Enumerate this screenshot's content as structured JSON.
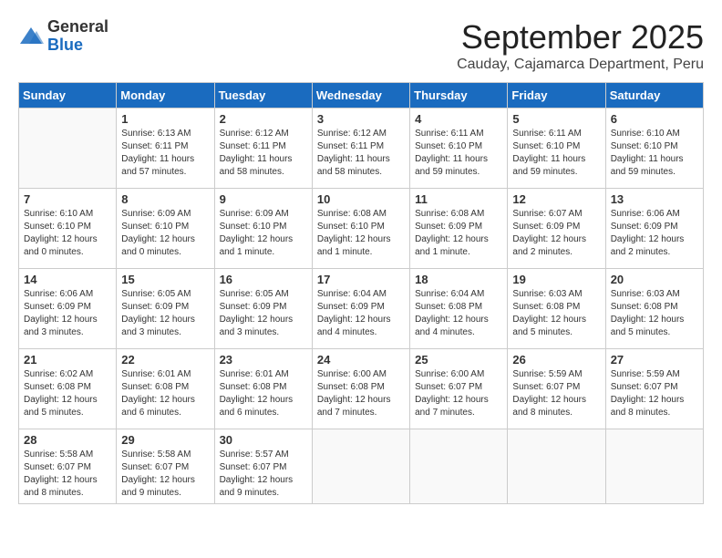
{
  "header": {
    "logo_general": "General",
    "logo_blue": "Blue",
    "month_title": "September 2025",
    "location": "Cauday, Cajamarca Department, Peru"
  },
  "days_of_week": [
    "Sunday",
    "Monday",
    "Tuesday",
    "Wednesday",
    "Thursday",
    "Friday",
    "Saturday"
  ],
  "weeks": [
    [
      {
        "day": "",
        "info": ""
      },
      {
        "day": "1",
        "info": "Sunrise: 6:13 AM\nSunset: 6:11 PM\nDaylight: 11 hours\nand 57 minutes."
      },
      {
        "day": "2",
        "info": "Sunrise: 6:12 AM\nSunset: 6:11 PM\nDaylight: 11 hours\nand 58 minutes."
      },
      {
        "day": "3",
        "info": "Sunrise: 6:12 AM\nSunset: 6:11 PM\nDaylight: 11 hours\nand 58 minutes."
      },
      {
        "day": "4",
        "info": "Sunrise: 6:11 AM\nSunset: 6:10 PM\nDaylight: 11 hours\nand 59 minutes."
      },
      {
        "day": "5",
        "info": "Sunrise: 6:11 AM\nSunset: 6:10 PM\nDaylight: 11 hours\nand 59 minutes."
      },
      {
        "day": "6",
        "info": "Sunrise: 6:10 AM\nSunset: 6:10 PM\nDaylight: 11 hours\nand 59 minutes."
      }
    ],
    [
      {
        "day": "7",
        "info": "Sunrise: 6:10 AM\nSunset: 6:10 PM\nDaylight: 12 hours\nand 0 minutes."
      },
      {
        "day": "8",
        "info": "Sunrise: 6:09 AM\nSunset: 6:10 PM\nDaylight: 12 hours\nand 0 minutes."
      },
      {
        "day": "9",
        "info": "Sunrise: 6:09 AM\nSunset: 6:10 PM\nDaylight: 12 hours\nand 1 minute."
      },
      {
        "day": "10",
        "info": "Sunrise: 6:08 AM\nSunset: 6:10 PM\nDaylight: 12 hours\nand 1 minute."
      },
      {
        "day": "11",
        "info": "Sunrise: 6:08 AM\nSunset: 6:09 PM\nDaylight: 12 hours\nand 1 minute."
      },
      {
        "day": "12",
        "info": "Sunrise: 6:07 AM\nSunset: 6:09 PM\nDaylight: 12 hours\nand 2 minutes."
      },
      {
        "day": "13",
        "info": "Sunrise: 6:06 AM\nSunset: 6:09 PM\nDaylight: 12 hours\nand 2 minutes."
      }
    ],
    [
      {
        "day": "14",
        "info": "Sunrise: 6:06 AM\nSunset: 6:09 PM\nDaylight: 12 hours\nand 3 minutes."
      },
      {
        "day": "15",
        "info": "Sunrise: 6:05 AM\nSunset: 6:09 PM\nDaylight: 12 hours\nand 3 minutes."
      },
      {
        "day": "16",
        "info": "Sunrise: 6:05 AM\nSunset: 6:09 PM\nDaylight: 12 hours\nand 3 minutes."
      },
      {
        "day": "17",
        "info": "Sunrise: 6:04 AM\nSunset: 6:09 PM\nDaylight: 12 hours\nand 4 minutes."
      },
      {
        "day": "18",
        "info": "Sunrise: 6:04 AM\nSunset: 6:08 PM\nDaylight: 12 hours\nand 4 minutes."
      },
      {
        "day": "19",
        "info": "Sunrise: 6:03 AM\nSunset: 6:08 PM\nDaylight: 12 hours\nand 5 minutes."
      },
      {
        "day": "20",
        "info": "Sunrise: 6:03 AM\nSunset: 6:08 PM\nDaylight: 12 hours\nand 5 minutes."
      }
    ],
    [
      {
        "day": "21",
        "info": "Sunrise: 6:02 AM\nSunset: 6:08 PM\nDaylight: 12 hours\nand 5 minutes."
      },
      {
        "day": "22",
        "info": "Sunrise: 6:01 AM\nSunset: 6:08 PM\nDaylight: 12 hours\nand 6 minutes."
      },
      {
        "day": "23",
        "info": "Sunrise: 6:01 AM\nSunset: 6:08 PM\nDaylight: 12 hours\nand 6 minutes."
      },
      {
        "day": "24",
        "info": "Sunrise: 6:00 AM\nSunset: 6:08 PM\nDaylight: 12 hours\nand 7 minutes."
      },
      {
        "day": "25",
        "info": "Sunrise: 6:00 AM\nSunset: 6:07 PM\nDaylight: 12 hours\nand 7 minutes."
      },
      {
        "day": "26",
        "info": "Sunrise: 5:59 AM\nSunset: 6:07 PM\nDaylight: 12 hours\nand 8 minutes."
      },
      {
        "day": "27",
        "info": "Sunrise: 5:59 AM\nSunset: 6:07 PM\nDaylight: 12 hours\nand 8 minutes."
      }
    ],
    [
      {
        "day": "28",
        "info": "Sunrise: 5:58 AM\nSunset: 6:07 PM\nDaylight: 12 hours\nand 8 minutes."
      },
      {
        "day": "29",
        "info": "Sunrise: 5:58 AM\nSunset: 6:07 PM\nDaylight: 12 hours\nand 9 minutes."
      },
      {
        "day": "30",
        "info": "Sunrise: 5:57 AM\nSunset: 6:07 PM\nDaylight: 12 hours\nand 9 minutes."
      },
      {
        "day": "",
        "info": ""
      },
      {
        "day": "",
        "info": ""
      },
      {
        "day": "",
        "info": ""
      },
      {
        "day": "",
        "info": ""
      }
    ]
  ]
}
